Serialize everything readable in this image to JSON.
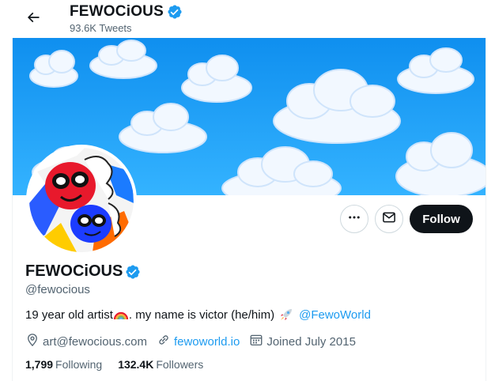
{
  "header": {
    "title": "FEWOCiOUS",
    "subtitle": "93.6K Tweets"
  },
  "profile": {
    "name": "FEWOCiOUS",
    "handle": "@fewocious",
    "bio_text": "19 year old artist",
    "bio_text_2": ". my name is victor (he/him)",
    "bio_mention": "@FewoWorld",
    "location": "art@fewocious.com",
    "website": "fewoworld.io",
    "joined": "Joined July 2015"
  },
  "stats": {
    "following_count": "1,799",
    "following_label": "Following",
    "followers_count": "132.4K",
    "followers_label": "Followers"
  },
  "actions": {
    "follow_label": "Follow"
  },
  "colors": {
    "accent": "#1d9bf0",
    "text_primary": "#0f1419",
    "text_secondary": "#536471",
    "follow_bg": "#0f1419",
    "banner_sky": "#1aa3ff"
  },
  "icons": {
    "back": "arrow-left-icon",
    "verified": "verified-badge-icon",
    "more": "more-dots-icon",
    "message": "envelope-icon",
    "location": "location-pin-icon",
    "link": "link-icon",
    "calendar": "calendar-icon",
    "rainbow": "rainbow-emoji",
    "rocket": "rocket-emoji"
  }
}
